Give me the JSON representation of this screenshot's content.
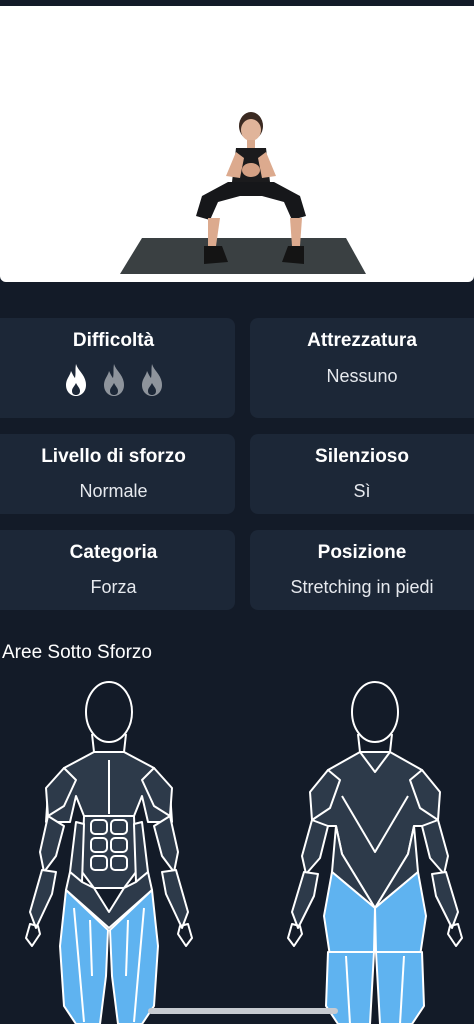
{
  "exercise": {
    "difficulty": {
      "title": "Difficoltà",
      "level": 1,
      "max": 3
    },
    "equipment": {
      "title": "Attrezzatura",
      "value": "Nessuno"
    },
    "effort": {
      "title": "Livello di sforzo",
      "value": "Normale"
    },
    "silent": {
      "title": "Silenzioso",
      "value": "Sì"
    },
    "category": {
      "title": "Categoria",
      "value": "Forza"
    },
    "position": {
      "title": "Posizione",
      "value": "Stretching in piedi"
    }
  },
  "stress_areas": {
    "title": "Aree Sotto Sforzo",
    "highlighted_muscles": [
      "quadriceps",
      "hamstrings"
    ]
  },
  "colors": {
    "background": "#131b28",
    "card": "#1c2737",
    "muscle_base": "#2d3a4a",
    "muscle_active": "#5fb3f0",
    "flame_active": "#ffffff",
    "flame_inactive": "#8e949c"
  },
  "icons": {
    "difficulty": "flame-icon"
  }
}
